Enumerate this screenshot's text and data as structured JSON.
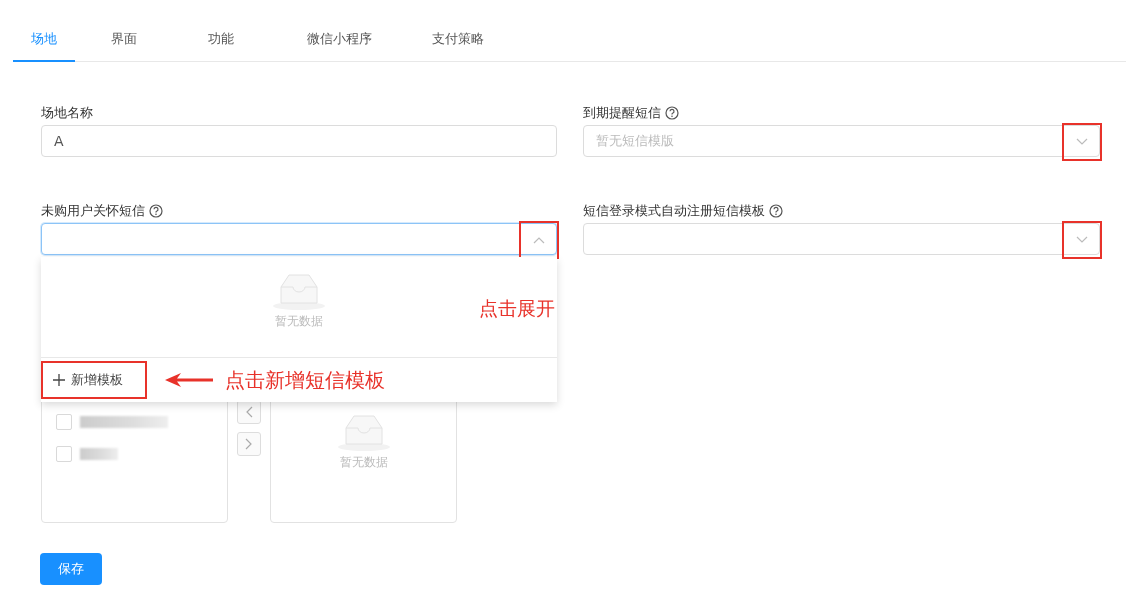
{
  "tabs": [
    {
      "label": "场地",
      "selected": true
    },
    {
      "label": "界面",
      "selected": false
    },
    {
      "label": "功能",
      "selected": false
    },
    {
      "label": "微信小程序",
      "selected": false
    },
    {
      "label": "支付策略",
      "selected": false
    }
  ],
  "form": {
    "fields": [
      {
        "kind": "input",
        "label": "场地名称",
        "help": false,
        "value": "A"
      },
      {
        "kind": "select",
        "label": "到期提醒短信",
        "help": true,
        "placeholder": "暂无短信模版",
        "expanded": false,
        "highlighted": true
      },
      {
        "kind": "select",
        "label": "未购用户关怀短信",
        "help": true,
        "expanded": true,
        "highlighted": true
      },
      {
        "kind": "select",
        "label": "短信登录模式自动注册短信模板",
        "help": true,
        "expanded": false,
        "highlighted": true
      }
    ]
  },
  "dropdown": {
    "empty_text": "暂无数据",
    "add_label": "新增模板",
    "add_highlighted": true
  },
  "transfer": {
    "left_items": [
      {
        "checked": false
      },
      {
        "checked": false
      }
    ],
    "right_empty_text": "暂无数据"
  },
  "save_button": "保存",
  "annotations": [
    {
      "kind": "expand",
      "text": "点击展开"
    },
    {
      "kind": "add",
      "text": "点击新增短信模板"
    }
  ]
}
